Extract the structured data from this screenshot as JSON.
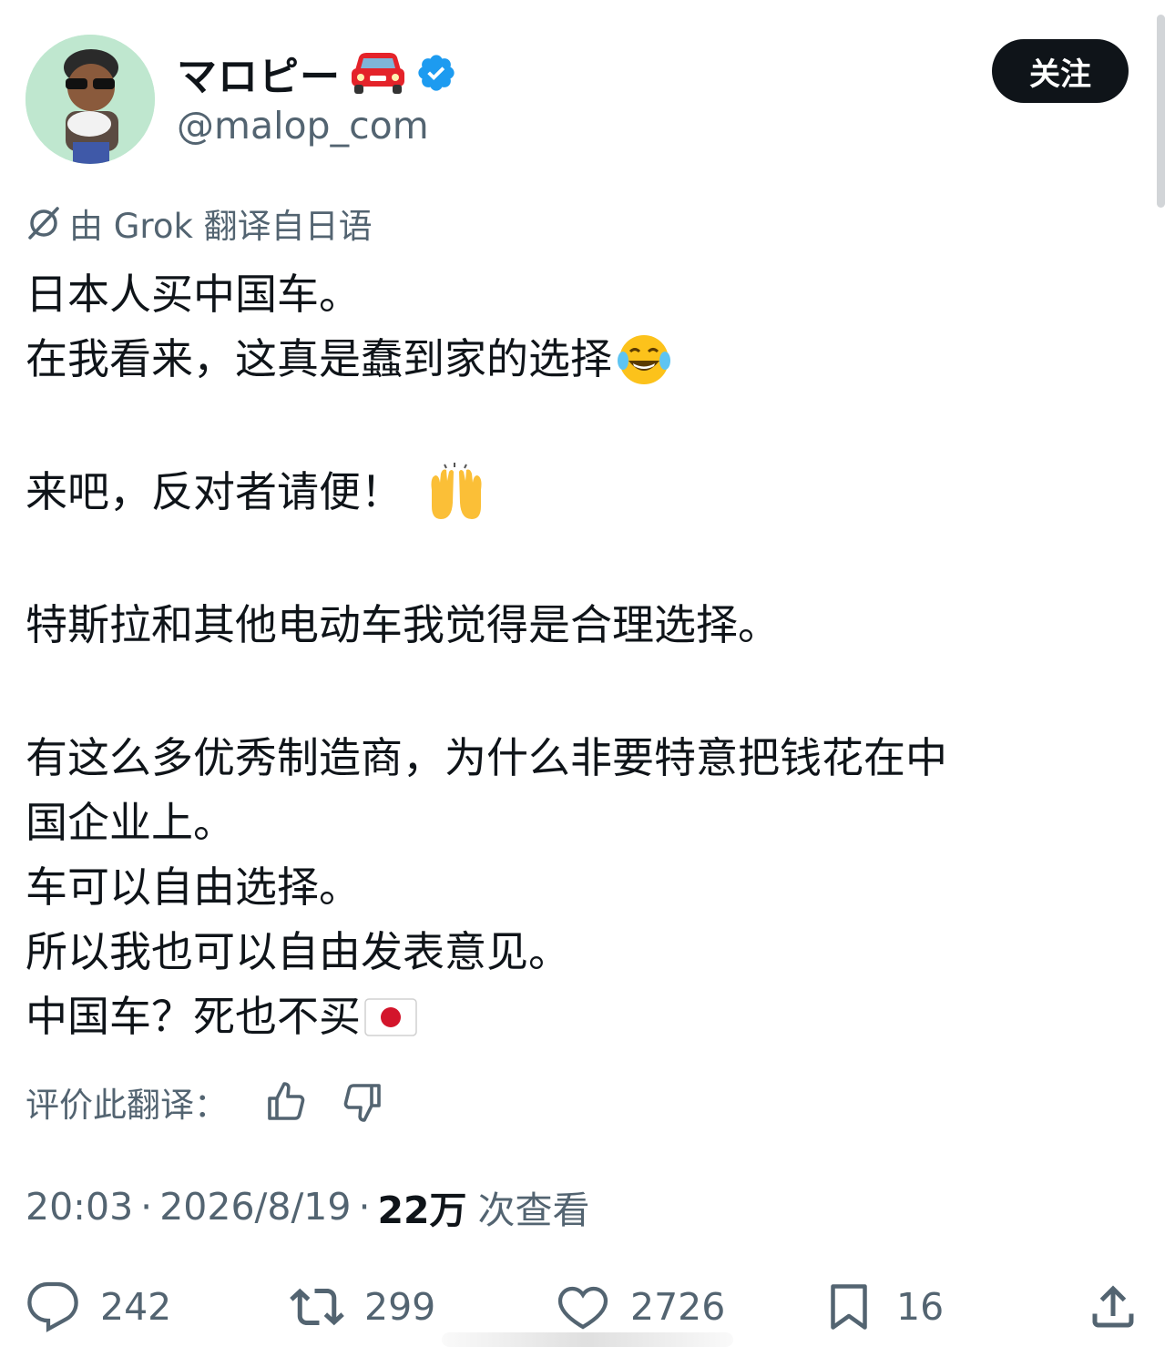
{
  "author": {
    "name": "マロピー",
    "handle": "@malop_com",
    "name_emoji_icon": "red-car-icon",
    "verified_icon": "verified-badge-icon",
    "verified_color": "#1d9bf0"
  },
  "follow_button": {
    "label": "关注"
  },
  "translation": {
    "icon": "grok-icon",
    "notice": "由 Grok 翻译自日语"
  },
  "tweet": {
    "lines": [
      "日本人买中国车。",
      "在我看来，这真是蠢到家的选择",
      "来吧，反对者请便！",
      "特斯拉和其他电动车我觉得是合理选择。",
      "有这么多优秀制造商，为什么非要特意把钱花在中",
      "国企业上。",
      "车可以自由选择。",
      "所以我也可以自由发表意见。",
      "中国车？死也不买"
    ],
    "emoji": {
      "line2": "face-with-tears-of-joy-icon",
      "line3": "raising-hands-icon",
      "line9": "japan-flag-icon"
    }
  },
  "rate": {
    "label": "评价此翻译：",
    "up_icon": "thumbs-up-icon",
    "down_icon": "thumbs-down-icon"
  },
  "meta": {
    "time": "20:03",
    "separator": "·",
    "date": "2026/8/19",
    "views_count": "22万",
    "views_label": "次查看"
  },
  "actions": {
    "replies": "242",
    "reposts": "299",
    "likes": "2726",
    "bookmarks": "16"
  },
  "colors": {
    "text": "#0f1419",
    "secondary": "#536471",
    "button_bg": "#0f1419"
  }
}
